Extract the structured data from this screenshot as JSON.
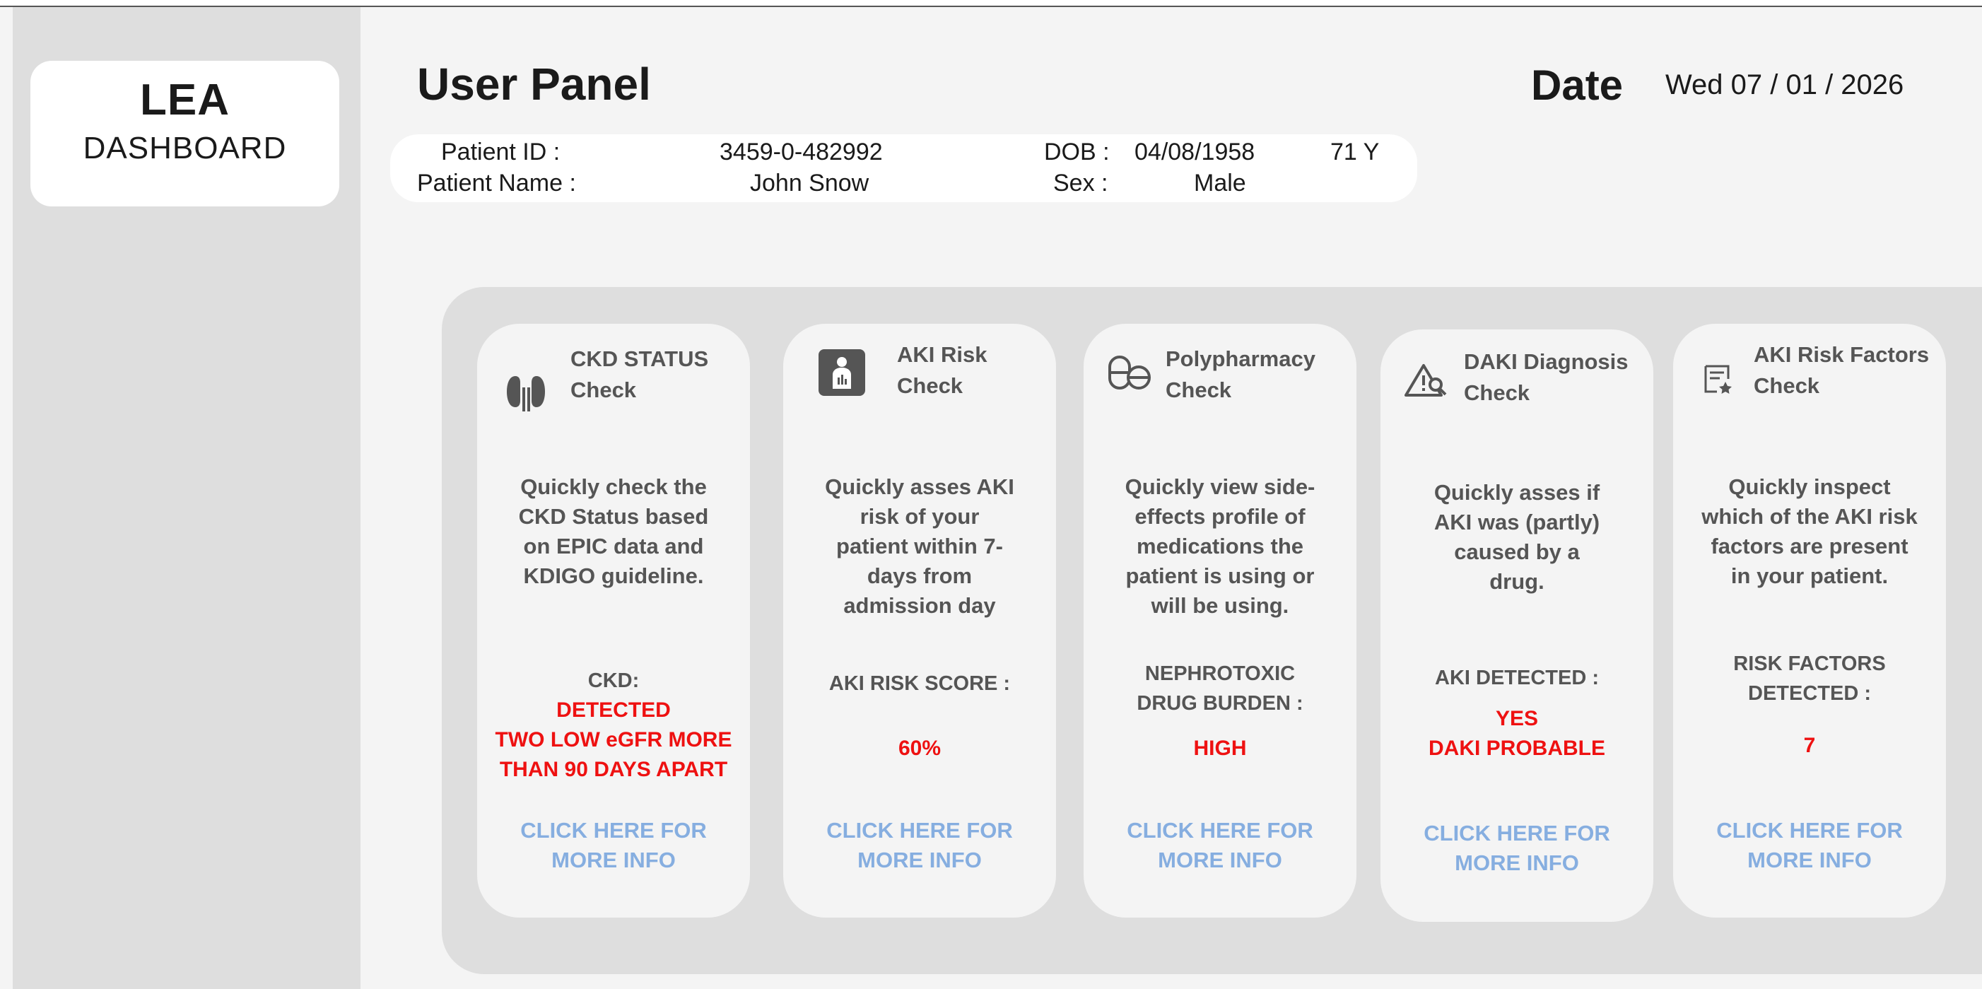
{
  "app": {
    "logo_line1": "LEA",
    "logo_line2": "DASHBOARD"
  },
  "header": {
    "title": "User Panel",
    "date_label": "Date",
    "date_value": "Wed  07 / 01 / 2026"
  },
  "patient": {
    "id_label": "Patient ID :",
    "id_value": "3459-0-482992",
    "name_label": "Patient Name :",
    "name_value": "John Snow",
    "dob_label": "DOB :",
    "dob_value": "04/08/1958",
    "age_value": "71 Y",
    "sex_label": "Sex :",
    "sex_value": "Male"
  },
  "cards": [
    {
      "icon": "kidney-icon",
      "title": "CKD STATUS\nCheck",
      "description": "Quickly check the\nCKD Status based\non EPIC data and\nKDIGO guideline.",
      "label": "CKD:",
      "value": "DETECTED\nTWO LOW eGFR MORE\nTHAN  90 DAYS APART",
      "link": "CLICK HERE FOR\nMORE INFO"
    },
    {
      "icon": "patient-monitor-icon",
      "title": "AKI Risk\nCheck",
      "description": "Quickly asses AKI\nrisk of your\npatient within 7-\ndays from\nadmission day",
      "label": "AKI RISK SCORE :",
      "value": "60%",
      "link": "CLICK HERE FOR\nMORE INFO"
    },
    {
      "icon": "pills-icon",
      "title": "Polypharmacy\nCheck",
      "description": "Quickly view side-\neffects profile of\nmedications the\npatient is using or\nwill be using.",
      "label": "NEPHROTOXIC\nDRUG  BURDEN :",
      "value": "HIGH",
      "link": "CLICK HERE FOR\nMORE INFO"
    },
    {
      "icon": "warning-search-icon",
      "title": "DAKI Diagnosis\nCheck",
      "description": "Quickly asses if\nAKI was (partly)\ncaused by a\ndrug.",
      "label": "AKI DETECTED :",
      "value": "YES\nDAKI PROBABLE",
      "link": "CLICK HERE FOR\nMORE INFO"
    },
    {
      "icon": "checklist-star-icon",
      "title": "AKI Risk Factors\nCheck",
      "description": "Quickly inspect\nwhich of the AKI risk\nfactors are present\nin your patient.",
      "label": "RISK FACTORS\nDETECTED :",
      "value": "7",
      "link": "CLICK HERE FOR\nMORE INFO"
    }
  ],
  "colors": {
    "alert": "#ee1111",
    "link": "#86aee0",
    "sidebar": "#dedede",
    "card_bg": "#f4f4f4"
  }
}
